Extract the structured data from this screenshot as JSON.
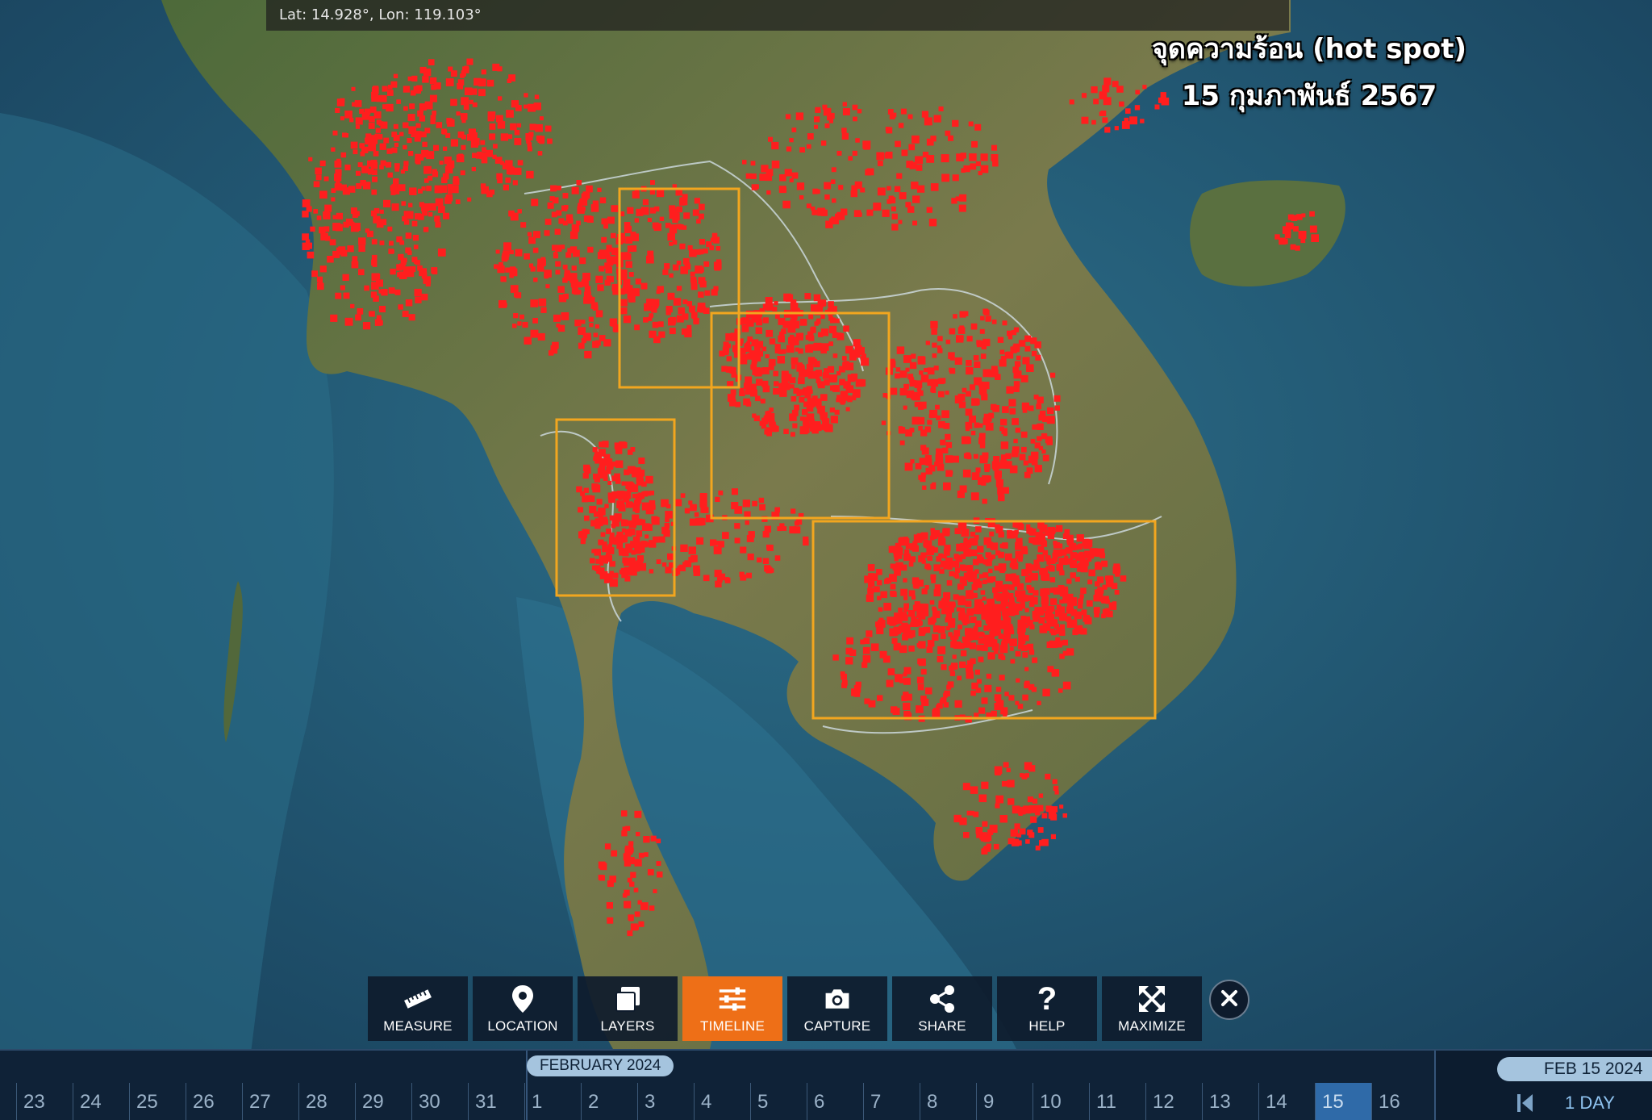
{
  "coords": {
    "text": "Lat: 14.928°, Lon: 119.103°"
  },
  "title": {
    "line1": "จุดความร้อน (hot spot)",
    "line2": "15 กุมภาพันธ์ 2567"
  },
  "colors": {
    "hotspot": "#ff1e1e",
    "highlight_box": "#f2a61f",
    "active_tool": "#ee6f17",
    "toolbar_bg": "#0e1b2c",
    "timeline_bg": "#0f2237"
  },
  "toolbar": {
    "items": [
      {
        "id": "measure",
        "label": "MEASURE",
        "icon": "ruler-icon",
        "active": false
      },
      {
        "id": "location",
        "label": "LOCATION",
        "icon": "map-pin-icon",
        "active": false
      },
      {
        "id": "layers",
        "label": "LAYERS",
        "icon": "layers-icon",
        "active": false
      },
      {
        "id": "timeline",
        "label": "TIMELINE",
        "icon": "sliders-icon",
        "active": true
      },
      {
        "id": "capture",
        "label": "CAPTURE",
        "icon": "camera-icon",
        "active": false
      },
      {
        "id": "share",
        "label": "SHARE",
        "icon": "share-icon",
        "active": false
      },
      {
        "id": "help",
        "label": "HELP",
        "icon": "question-icon",
        "active": false
      },
      {
        "id": "maximize",
        "label": "MAXIMIZE",
        "icon": "maximize-icon",
        "active": false
      }
    ],
    "close_icon": "close-icon"
  },
  "timeline": {
    "month_label": "FEBRUARY 2024",
    "days": [
      "23",
      "24",
      "25",
      "26",
      "27",
      "28",
      "29",
      "30",
      "31",
      "1",
      "2",
      "3",
      "4",
      "5",
      "6",
      "7",
      "8",
      "9",
      "10",
      "11",
      "12",
      "13",
      "14",
      "15",
      "16"
    ],
    "selected_day": "15",
    "current_date": "FEB 15 2024",
    "interval": "1 DAY",
    "prev_icon": "skip-back-icon"
  }
}
